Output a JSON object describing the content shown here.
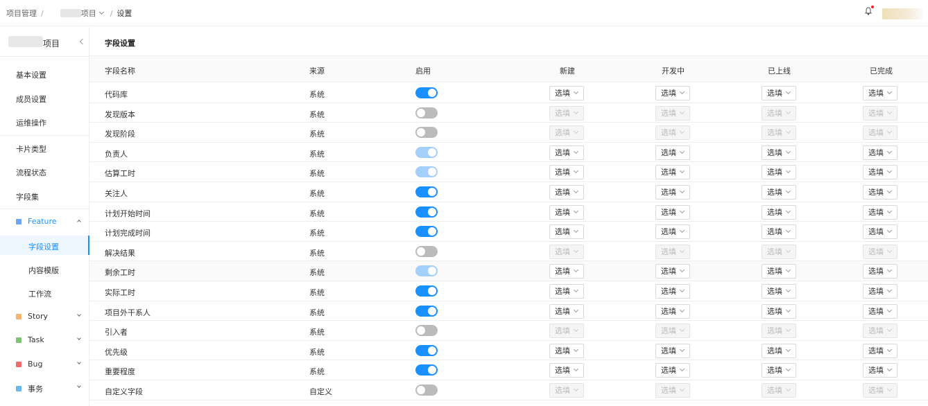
{
  "topbar": {
    "breadcrumb_root": "项目管理",
    "breadcrumb_project": "项目",
    "breadcrumb_current": "设置"
  },
  "sidebar": {
    "project_title": "项目",
    "items": [
      {
        "label": "基本设置"
      },
      {
        "label": "成员设置"
      },
      {
        "label": "运维操作"
      },
      {
        "label": "卡片类型"
      },
      {
        "label": "流程状态"
      },
      {
        "label": "字段集"
      }
    ],
    "groups": [
      {
        "label": "Feature",
        "color": "#69a7f5",
        "expanded": true,
        "children": [
          {
            "label": "字段设置",
            "active": true
          },
          {
            "label": "内容模版"
          },
          {
            "label": "工作流"
          }
        ]
      },
      {
        "label": "Story",
        "color": "#f7b46b"
      },
      {
        "label": "Task",
        "color": "#7cc576"
      },
      {
        "label": "Bug",
        "color": "#f26b6b"
      },
      {
        "label": "事务",
        "color": "#6ab7f2"
      }
    ]
  },
  "main": {
    "title": "字段设置",
    "columns": [
      "字段名称",
      "来源",
      "启用",
      "新建",
      "开发中",
      "已上线",
      "已完成"
    ],
    "rows": [
      {
        "name": "代码库",
        "source": "系统",
        "enabled": "on",
        "select": "选填"
      },
      {
        "name": "发现版本",
        "source": "系统",
        "enabled": "off",
        "select": "选填"
      },
      {
        "name": "发现阶段",
        "source": "系统",
        "enabled": "off",
        "select": "选填"
      },
      {
        "name": "负责人",
        "source": "系统",
        "enabled": "locked",
        "select": "选填"
      },
      {
        "name": "估算工时",
        "source": "系统",
        "enabled": "locked",
        "select": "选填"
      },
      {
        "name": "关注人",
        "source": "系统",
        "enabled": "on",
        "select": "选填"
      },
      {
        "name": "计划开始时间",
        "source": "系统",
        "enabled": "on",
        "select": "选填"
      },
      {
        "name": "计划完成时间",
        "source": "系统",
        "enabled": "on",
        "select": "选填"
      },
      {
        "name": "解决结果",
        "source": "系统",
        "enabled": "off",
        "select": "选填"
      },
      {
        "name": "剩余工时",
        "source": "系统",
        "enabled": "locked",
        "select": "选填"
      },
      {
        "name": "实际工时",
        "source": "系统",
        "enabled": "on",
        "select": "选填"
      },
      {
        "name": "项目外干系人",
        "source": "系统",
        "enabled": "on",
        "select": "选填"
      },
      {
        "name": "引入者",
        "source": "系统",
        "enabled": "off",
        "select": "选填"
      },
      {
        "name": "优先级",
        "source": "系统",
        "enabled": "on",
        "select": "选填"
      },
      {
        "name": "重要程度",
        "source": "系统",
        "enabled": "on",
        "select": "选填"
      },
      {
        "name": "自定义字段",
        "source": "自定义",
        "enabled": "off",
        "select": "选填"
      }
    ]
  }
}
